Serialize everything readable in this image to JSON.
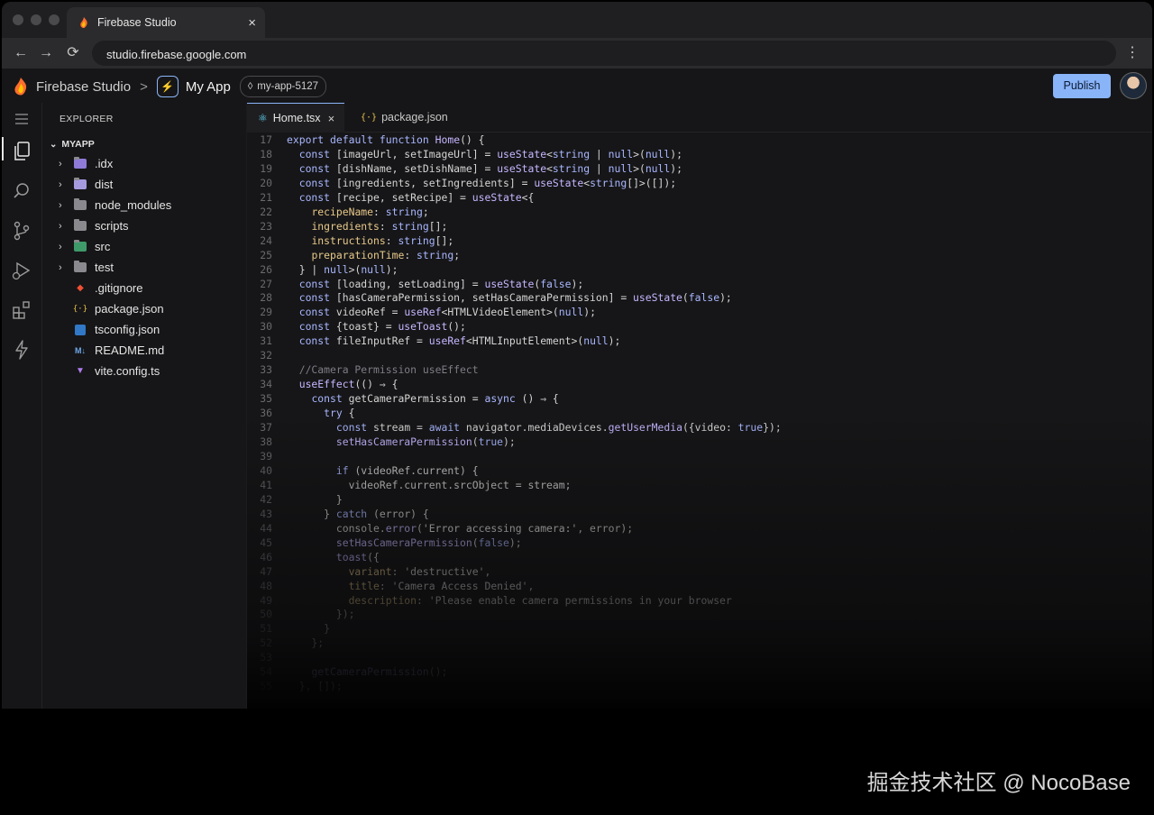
{
  "browser": {
    "tab_title": "Firebase Studio",
    "tab_close": "×",
    "url": "studio.firebase.google.com",
    "back": "←",
    "forward": "→",
    "reload": "⟳",
    "menu": "⋮"
  },
  "app": {
    "brand": "Firebase Studio",
    "separator": ">",
    "project": "My App",
    "workspace": "my-app-5127",
    "publish": "Publish"
  },
  "explorer": {
    "title": "EXPLORER",
    "root": "MYAPP",
    "items": [
      {
        "label": ".idx",
        "type": "folder"
      },
      {
        "label": "dist",
        "type": "folder"
      },
      {
        "label": "node_modules",
        "type": "folder"
      },
      {
        "label": "scripts",
        "type": "folder"
      },
      {
        "label": "src",
        "type": "folder"
      },
      {
        "label": "test",
        "type": "folder"
      },
      {
        "label": ".gitignore",
        "type": "file"
      },
      {
        "label": "package.json",
        "type": "file"
      },
      {
        "label": "tsconfig.json",
        "type": "file"
      },
      {
        "label": "README.md",
        "type": "file"
      },
      {
        "label": "vite.config.ts",
        "type": "file"
      }
    ]
  },
  "editor": {
    "tabs": [
      {
        "label": "Home.tsx",
        "active": true
      },
      {
        "label": "package.json",
        "active": false
      }
    ],
    "lines": [
      {
        "n": "17",
        "code": "export default function Home() {"
      },
      {
        "n": "18",
        "code": "  const [imageUrl, setImageUrl] = useState<string | null>(null);"
      },
      {
        "n": "19",
        "code": "  const [dishName, setDishName] = useState<string | null>(null);"
      },
      {
        "n": "20",
        "code": "  const [ingredients, setIngredients] = useState<string[]>([]);"
      },
      {
        "n": "21",
        "code": "  const [recipe, setRecipe] = useState<{"
      },
      {
        "n": "22",
        "code": "    recipeName: string;"
      },
      {
        "n": "23",
        "code": "    ingredients: string[];"
      },
      {
        "n": "24",
        "code": "    instructions: string[];"
      },
      {
        "n": "25",
        "code": "    preparationTime: string;"
      },
      {
        "n": "26",
        "code": "  } | null>(null);"
      },
      {
        "n": "27",
        "code": "  const [loading, setLoading] = useState(false);"
      },
      {
        "n": "28",
        "code": "  const [hasCameraPermission, setHasCameraPermission] = useState(false);"
      },
      {
        "n": "29",
        "code": "  const videoRef = useRef<HTMLVideoElement>(null);"
      },
      {
        "n": "30",
        "code": "  const {toast} = useToast();"
      },
      {
        "n": "31",
        "code": "  const fileInputRef = useRef<HTMLInputElement>(null);"
      },
      {
        "n": "32",
        "code": ""
      },
      {
        "n": "33",
        "code": "  //Camera Permission useEffect"
      },
      {
        "n": "34",
        "code": "  useEffect(() ⇒ {"
      },
      {
        "n": "35",
        "code": "    const getCameraPermission = async () ⇒ {"
      },
      {
        "n": "36",
        "code": "      try {"
      },
      {
        "n": "37",
        "code": "        const stream = await navigator.mediaDevices.getUserMedia({video: true});"
      },
      {
        "n": "38",
        "code": "        setHasCameraPermission(true);"
      },
      {
        "n": "39",
        "code": ""
      },
      {
        "n": "40",
        "code": "        if (videoRef.current) {"
      },
      {
        "n": "41",
        "code": "          videoRef.current.srcObject = stream;"
      },
      {
        "n": "42",
        "code": "        }"
      },
      {
        "n": "43",
        "code": "      } catch (error) {"
      },
      {
        "n": "44",
        "code": "        console.error('Error accessing camera:', error);"
      },
      {
        "n": "45",
        "code": "        setHasCameraPermission(false);"
      },
      {
        "n": "46",
        "code": "        toast({"
      },
      {
        "n": "47",
        "code": "          variant: 'destructive',"
      },
      {
        "n": "48",
        "code": "          title: 'Camera Access Denied',"
      },
      {
        "n": "49",
        "code": "          description: 'Please enable camera permissions in your browser"
      },
      {
        "n": "50",
        "code": "        });"
      },
      {
        "n": "51",
        "code": "      }"
      },
      {
        "n": "52",
        "code": "    };"
      },
      {
        "n": "53",
        "code": ""
      },
      {
        "n": "54",
        "code": "    getCameraPermission();"
      },
      {
        "n": "55",
        "code": "  }, []);"
      }
    ]
  },
  "watermark": "掘金技术社区 @ NocoBase",
  "colors": {
    "accent": "#8ab4f8",
    "background": "#161618",
    "keyword": "#a9b7ff",
    "property": "#e8c98a"
  }
}
